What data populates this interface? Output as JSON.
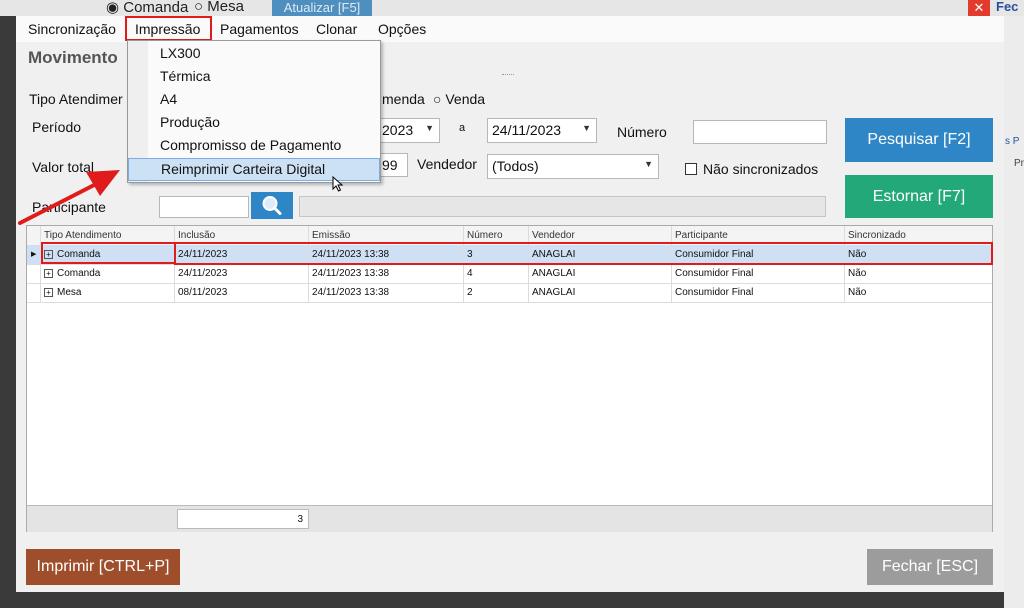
{
  "background": {
    "radio_comanda": "◉ Comanda",
    "radio_mesa": "○ Mesa",
    "button_update": "Atualizar [F5]",
    "close_button_glyph": "✕",
    "fechar_label": "Fec",
    "right_link_1": "s P",
    "right_link_2": "Pr"
  },
  "menubar": {
    "items": [
      "Sincronização",
      "Impressão",
      "Pagamentos",
      "Clonar",
      "Opções"
    ]
  },
  "window": {
    "title": "Movimento"
  },
  "filters": {
    "tipo_label": "Tipo Atendimer",
    "radio_comanda_partial": "menda",
    "radio_venda": "○ Venda",
    "periodo_label": "Período",
    "date_from_partial": "2023",
    "date_separator": "a",
    "date_to": "24/11/2023",
    "numero_label": "Número",
    "numero_value": "",
    "valor_total_label": "Valor total",
    "valor_partial": "99",
    "vendedor_label": "Vendedor",
    "vendedor_value": "(Todos)",
    "nao_sincronizados_label": "Não sincronizados",
    "participante_label": "Participante",
    "participante_value": ""
  },
  "buttons": {
    "pesquisar": "Pesquisar [F2]",
    "estornar": "Estornar [F7]",
    "imprimir": "Imprimir [CTRL+P]",
    "fechar": "Fechar [ESC]"
  },
  "grid": {
    "columns": [
      "Tipo Atendimento",
      "Inclusão",
      "Emissão",
      "Número",
      "Vendedor",
      "Participante",
      "Sincronizado"
    ],
    "rows": [
      [
        "Comanda",
        "24/11/2023",
        "24/11/2023 13:38",
        "3",
        "ANAGLAI",
        "Consumidor Final",
        "Não"
      ],
      [
        "Comanda",
        "24/11/2023",
        "24/11/2023 13:38",
        "4",
        "ANAGLAI",
        "Consumidor Final",
        "Não"
      ],
      [
        "Mesa",
        "08/11/2023",
        "24/11/2023 13:38",
        "2",
        "ANAGLAI",
        "Consumidor Final",
        "Não"
      ]
    ],
    "footer_count": "3"
  },
  "dropdown": {
    "items": [
      "LX300",
      "Térmica",
      "A4",
      "Produção",
      "Compromisso de Pagamento",
      "Reimprimir Carteira Digital"
    ],
    "highlighted_index": 5
  },
  "colors": {
    "highlight_red": "#e01b1b",
    "pesquisar_blue": "#2e86c7",
    "estornar_green": "#23a879",
    "imprimir_brown": "#9e4e2a",
    "fechar_gray": "#9c9c9c"
  }
}
